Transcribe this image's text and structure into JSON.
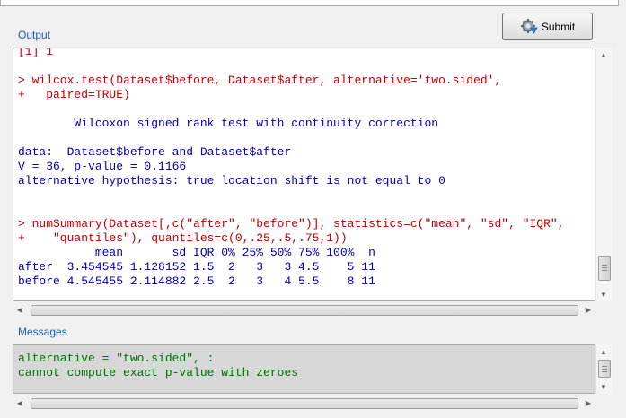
{
  "toolbar": {
    "submit_label": "Submit"
  },
  "output": {
    "label": "Output",
    "lines": [
      {
        "text": "[1] 1",
        "color": "red"
      },
      {
        "text": "",
        "color": "red"
      },
      {
        "text": "> wilcox.test(Dataset$before, Dataset$after, alternative='two.sided',",
        "color": "red"
      },
      {
        "text": "+   paired=TRUE)",
        "color": "red"
      },
      {
        "text": "",
        "color": "blue"
      },
      {
        "text": "        Wilcoxon signed rank test with continuity correction",
        "color": "blue"
      },
      {
        "text": "",
        "color": "blue"
      },
      {
        "text": "data:  Dataset$before and Dataset$after",
        "color": "blue"
      },
      {
        "text": "V = 36, p-value = 0.1166",
        "color": "blue"
      },
      {
        "text": "alternative hypothesis: true location shift is not equal to 0",
        "color": "blue"
      },
      {
        "text": "",
        "color": "blue"
      },
      {
        "text": "",
        "color": "blue"
      },
      {
        "text": "> numSummary(Dataset[,c(\"after\", \"before\")], statistics=c(\"mean\", \"sd\", \"IQR\",",
        "color": "red"
      },
      {
        "text": "+    \"quantiles\"), quantiles=c(0,.25,.5,.75,1))",
        "color": "red"
      },
      {
        "text": "           mean       sd IQR 0% 25% 50% 75% 100%  n",
        "color": "blue"
      },
      {
        "text": "after  3.454545 1.128152 1.5  2   3   3 4.5    5 11",
        "color": "blue"
      },
      {
        "text": "before 4.545455 2.114882 2.5  2   3   4 5.5    8 11",
        "color": "blue"
      }
    ]
  },
  "messages": {
    "label": "Messages",
    "lines": [
      {
        "text": "alternative = \"two.sided\", :"
      },
      {
        "text": "cannot compute exact p-value with zeroes"
      }
    ]
  }
}
